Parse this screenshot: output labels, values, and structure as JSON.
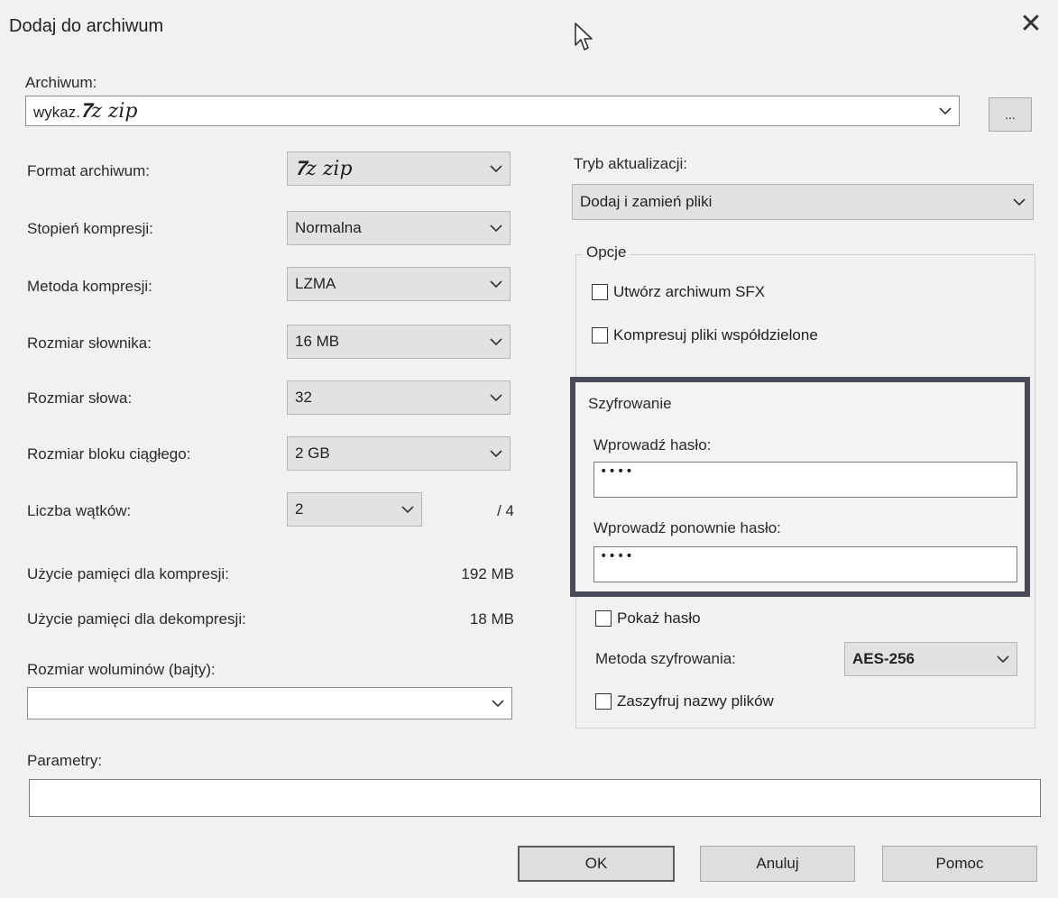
{
  "window": {
    "title": "Dodaj do archiwum",
    "close_glyph": "✕"
  },
  "archive": {
    "label": "Archiwum:",
    "value_prefix": "wykaz.",
    "value_handwritten": "𝟕z zip",
    "browse_label": "..."
  },
  "left": {
    "format": {
      "label": "Format archiwum:",
      "value": "𝟕z zip"
    },
    "compression_level": {
      "label": "Stopień kompresji:",
      "value": "Normalna"
    },
    "compression_method": {
      "label": "Metoda kompresji:",
      "value": "LZMA"
    },
    "dictionary_size": {
      "label": "Rozmiar słownika:",
      "value": "16 MB"
    },
    "word_size": {
      "label": "Rozmiar słowa:",
      "value": "32"
    },
    "solid_block_size": {
      "label": "Rozmiar bloku ciągłego:",
      "value": "2 GB"
    },
    "threads": {
      "label": "Liczba wątków:",
      "value": "2",
      "max": "/ 4"
    },
    "memory_compress": {
      "label": "Użycie pamięci dla kompresji:",
      "value": "192 MB"
    },
    "memory_decompress": {
      "label": "Użycie pamięci dla dekompresji:",
      "value": "18 MB"
    },
    "volume_size": {
      "label": "Rozmiar woluminów (bajty):",
      "value": ""
    }
  },
  "right": {
    "update_mode": {
      "label": "Tryb aktualizacji:",
      "value": "Dodaj i zamień pliki"
    },
    "options": {
      "legend": "Opcje",
      "sfx": "Utwórz archiwum SFX",
      "shared": "Kompresuj pliki współdzielone"
    },
    "encryption": {
      "legend": "Szyfrowanie",
      "password_label": "Wprowadź hasło:",
      "password_value": "••••",
      "repeat_label": "Wprowadź ponownie hasło:",
      "repeat_value": "••••",
      "show_password": "Pokaż hasło",
      "method_label": "Metoda szyfrowania:",
      "method_value": "AES-256",
      "encrypt_names": "Zaszyfruj nazwy plików"
    }
  },
  "parameters": {
    "label": "Parametry:",
    "value": ""
  },
  "buttons": {
    "ok": "OK",
    "cancel": "Anuluj",
    "help": "Pomoc"
  },
  "colors": {
    "encryption_border": "#474b5a",
    "background": "#f1f1f1"
  }
}
